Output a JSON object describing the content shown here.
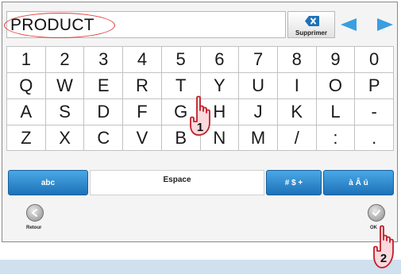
{
  "input": {
    "value": "PRODUCT"
  },
  "toolbar": {
    "delete_label": "Supprimer"
  },
  "keyboard": {
    "rows": [
      [
        "1",
        "2",
        "3",
        "4",
        "5",
        "6",
        "7",
        "8",
        "9",
        "0"
      ],
      [
        "Q",
        "W",
        "E",
        "R",
        "T",
        "Y",
        "U",
        "I",
        "O",
        "P"
      ],
      [
        "A",
        "S",
        "D",
        "F",
        "G",
        "H",
        "J",
        "K",
        "L",
        "-"
      ],
      [
        "Z",
        "X",
        "C",
        "V",
        "B",
        "N",
        "M",
        "/",
        ":",
        "."
      ]
    ],
    "function_keys": {
      "abc": "abc",
      "space": "Espace",
      "symbols": "# $ +",
      "accents": "à Â ú"
    }
  },
  "footer": {
    "back_label": "Retour",
    "ok_label": "OK"
  },
  "callouts": {
    "step_1": "1",
    "step_2": "2"
  },
  "colors": {
    "accent": "#3a9ee0",
    "highlight": "#e03b3b",
    "hand_fill": "#fbd9dd",
    "hand_stroke": "#c0202a"
  }
}
